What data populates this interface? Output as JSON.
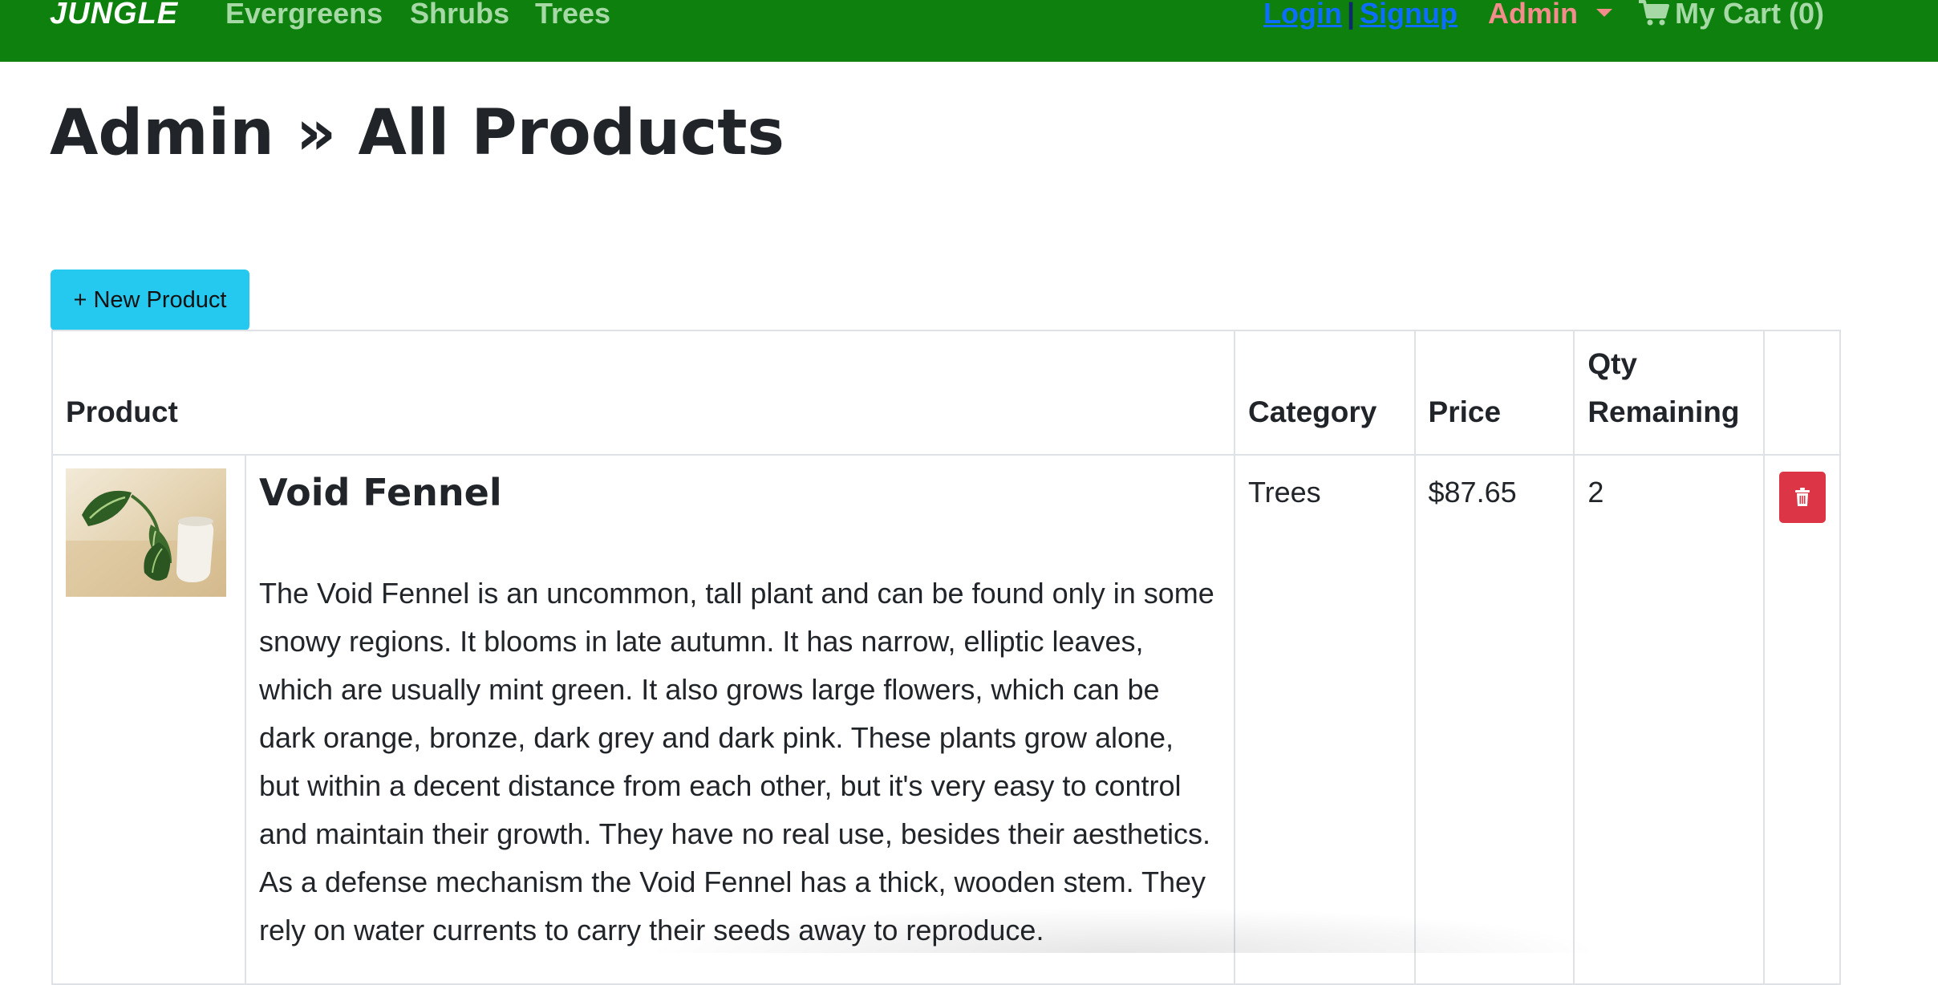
{
  "navbar": {
    "brand": "JUNGLE",
    "links": [
      "Evergreens",
      "Shrubs",
      "Trees"
    ],
    "login": "Login",
    "separator": "|",
    "signup": "Signup",
    "admin": "Admin",
    "cart": "My Cart (0)",
    "colors": {
      "background": "#0e800e",
      "link": "#a6d9a6",
      "auth_link": "#0d6efd",
      "admin": "#f58c8c"
    }
  },
  "page": {
    "title": "Admin » All Products"
  },
  "toolbar": {
    "new_product_label": "+ New Product",
    "new_product_color": "#25c8ee"
  },
  "table": {
    "headers": {
      "product": "Product",
      "category": "Category",
      "price": "Price",
      "qty": "Qty Remaining"
    },
    "rows": [
      {
        "name": "Void Fennel",
        "description": "The Void Fennel is an uncommon, tall plant and can be found only in some snowy regions. It blooms in late autumn. It has narrow, elliptic leaves, which are usually mint green. It also grows large flowers, which can be dark orange, bronze, dark grey and dark pink. These plants grow alone, but within a decent distance from each other, but it's very easy to control and maintain their growth. They have no real use, besides their aesthetics. As a defense mechanism the Void Fennel has a thick, wooden stem. They rely on water currents to carry their seeds away to reproduce.",
        "category": "Trees",
        "price": "$87.65",
        "qty": "2",
        "thumbnail_icon": "plant-photo",
        "delete_icon": "trash-icon",
        "delete_color": "#dc3545"
      }
    ]
  }
}
